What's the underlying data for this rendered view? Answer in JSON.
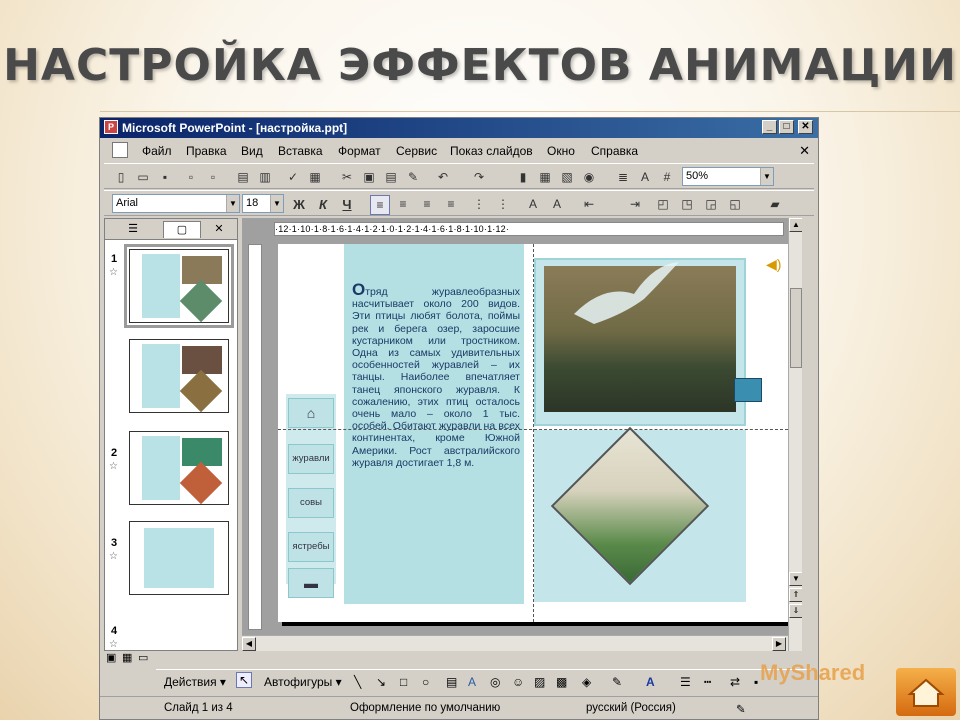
{
  "slide": {
    "title": "НАСТРОЙКА ЭФФЕКТОВ АНИМАЦИИ"
  },
  "window": {
    "title": "Microsoft PowerPoint - [настройка.ppt]",
    "controls": [
      "_",
      "□",
      "✕"
    ]
  },
  "menu": {
    "items": [
      "Файл",
      "Правка",
      "Вид",
      "Вставка",
      "Формат",
      "Сервис",
      "Показ слайдов",
      "Окно",
      "Справка"
    ],
    "close": "✕"
  },
  "toolbar": {
    "zoom": "50%"
  },
  "format_toolbar": {
    "font": "Arial",
    "size": "18",
    "bold": "Ж",
    "italic": "К",
    "underline": "Ч"
  },
  "panel": {
    "slides": [
      {
        "num": "1"
      },
      {
        "num": "2"
      },
      {
        "num": "3"
      },
      {
        "num": "4"
      }
    ]
  },
  "ruler": {
    "h": "·12·1·10·1·8·1·6·1·4·1·2·1·0·1·2·1·4·1·6·1·8·1·10·1·12·"
  },
  "content": {
    "text_first": "О",
    "text": "тряд журавлеобразных насчитывает около 200 видов. Эти птицы любят болота, поймы рек и берега озер, заросшие кустарником или тростником. Одна из самых удивительных особенностей журавлей – их танцы. Наиболее впечатляет танец японского журавля. К сожалению, этих птиц осталось очень мало – около 1 тыс. особей. Обитают журавли на всех континентах, кроме Южной Америки. Рост австралийского журавля достигает 1,8 м.",
    "nav": [
      "журавли",
      "совы",
      "ястребы"
    ]
  },
  "drawbar": {
    "actions": "Действия ▾",
    "autoshapes": "Автофигуры ▾"
  },
  "status": {
    "slide": "Слайд 1 из 4",
    "design": "Оформление по умолчанию",
    "language": "русский (Россия)"
  },
  "watermark": "MyShared"
}
